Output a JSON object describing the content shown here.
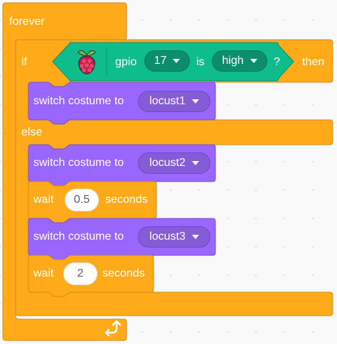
{
  "blocks": {
    "forever_label": "forever",
    "if_label": "if",
    "then_label": "then",
    "else_label": "else",
    "gpio_label": "gpio",
    "pin_value": "17",
    "is_label": "is",
    "state_value": "high",
    "question_label": "?",
    "switch_costume_label": "switch costume to",
    "costume_1": "locust1",
    "costume_2": "locust2",
    "costume_3": "locust3",
    "wait_label": "wait",
    "wait_1_value": "0.5",
    "seconds_label": "seconds",
    "wait_2_value": "2"
  },
  "colors": {
    "control": "#ffab19",
    "control_border": "#cf8b17",
    "looks": "#9966ff",
    "looks_border": "#774dcb",
    "extension": "#0fbd8c",
    "extension_border": "#0b8e69"
  },
  "icons": {
    "extension_icon": "raspberry-pi-icon",
    "loop_icon": "loop-arrow-icon"
  }
}
